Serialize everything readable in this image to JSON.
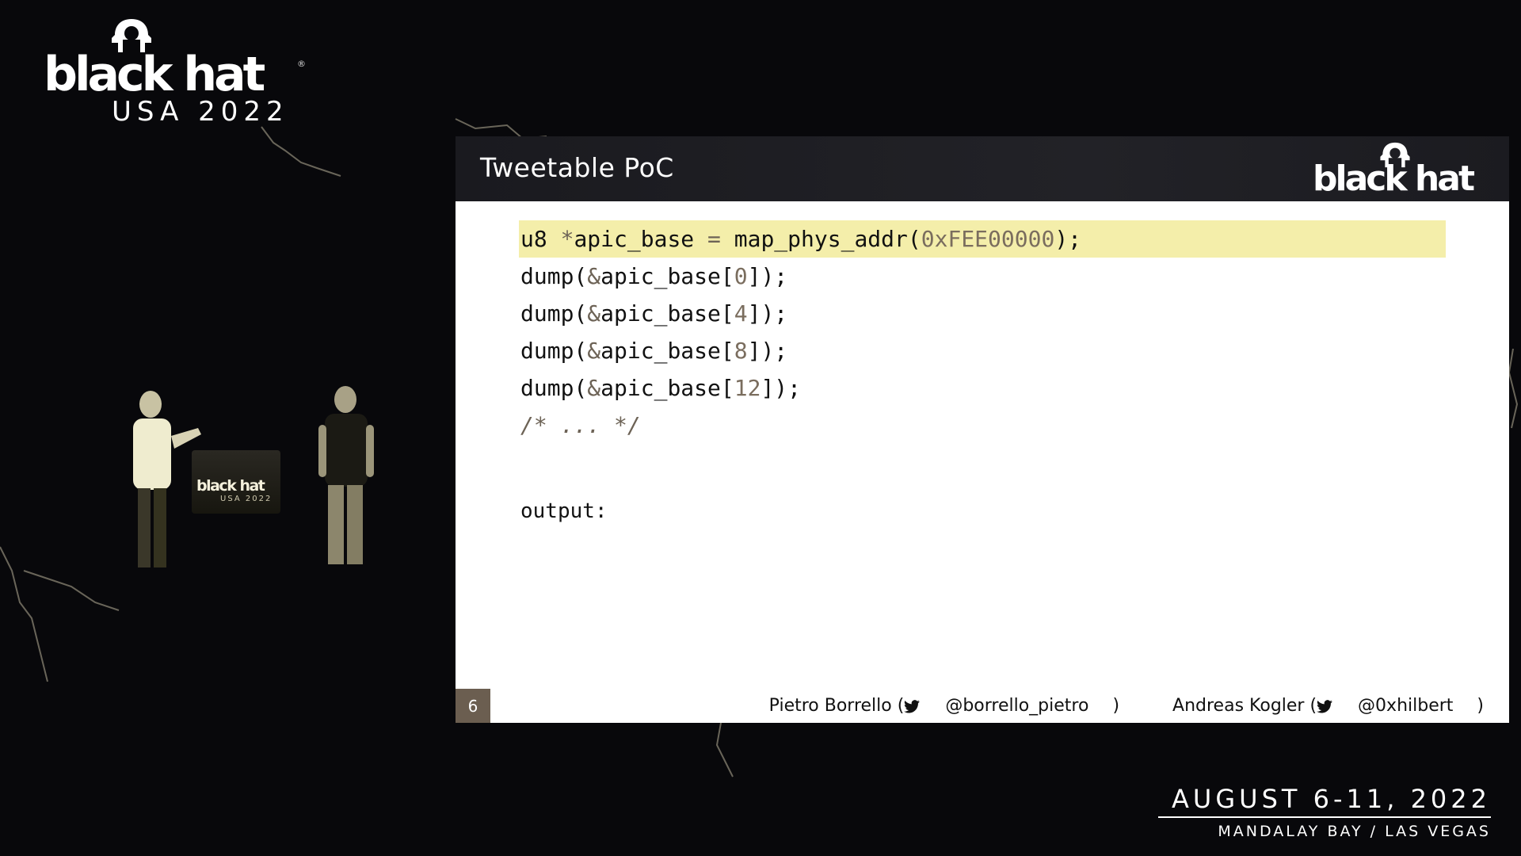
{
  "brand": {
    "logo_text": "black hat",
    "registered_mark": "®",
    "event_name": "USA 2022",
    "dates": "AUGUST 6-11, 2022",
    "venue": "MANDALAY BAY / LAS VEGAS"
  },
  "stage": {
    "podium_logo_text": "black hat",
    "podium_sub": "USA 2022"
  },
  "slide": {
    "title": "Tweetable PoC",
    "header_logo_text": "black hat",
    "code_lines": [
      {
        "a": "u8 ",
        "op": "*",
        "b": "apic_base ",
        "op2": "=",
        "c": " map_phys_addr(",
        "num": "0xFEE00000",
        "d": ");",
        "highlight": true
      },
      {
        "a": "dump(",
        "op": "&",
        "b": "apic_base[",
        "num": "0",
        "d": "]);"
      },
      {
        "a": "dump(",
        "op": "&",
        "b": "apic_base[",
        "num": "4",
        "d": "]);"
      },
      {
        "a": "dump(",
        "op": "&",
        "b": "apic_base[",
        "num": "8",
        "d": "]);"
      },
      {
        "a": "dump(",
        "op": "&",
        "b": "apic_base[",
        "num": "12",
        "d": "]);"
      }
    ],
    "comment": "/* ... */",
    "output_label": "output:",
    "page_number": "6",
    "authors": [
      {
        "name": "Pietro Borrello (",
        "handle": "@borrello_pietro",
        "close": ")"
      },
      {
        "name": "Andreas Kogler (",
        "handle": "@0xhilbert",
        "close": ")"
      }
    ]
  },
  "colors": {
    "highlight": "#f4eeaa",
    "page_badge": "#6b5e50",
    "background": "#08080b"
  }
}
